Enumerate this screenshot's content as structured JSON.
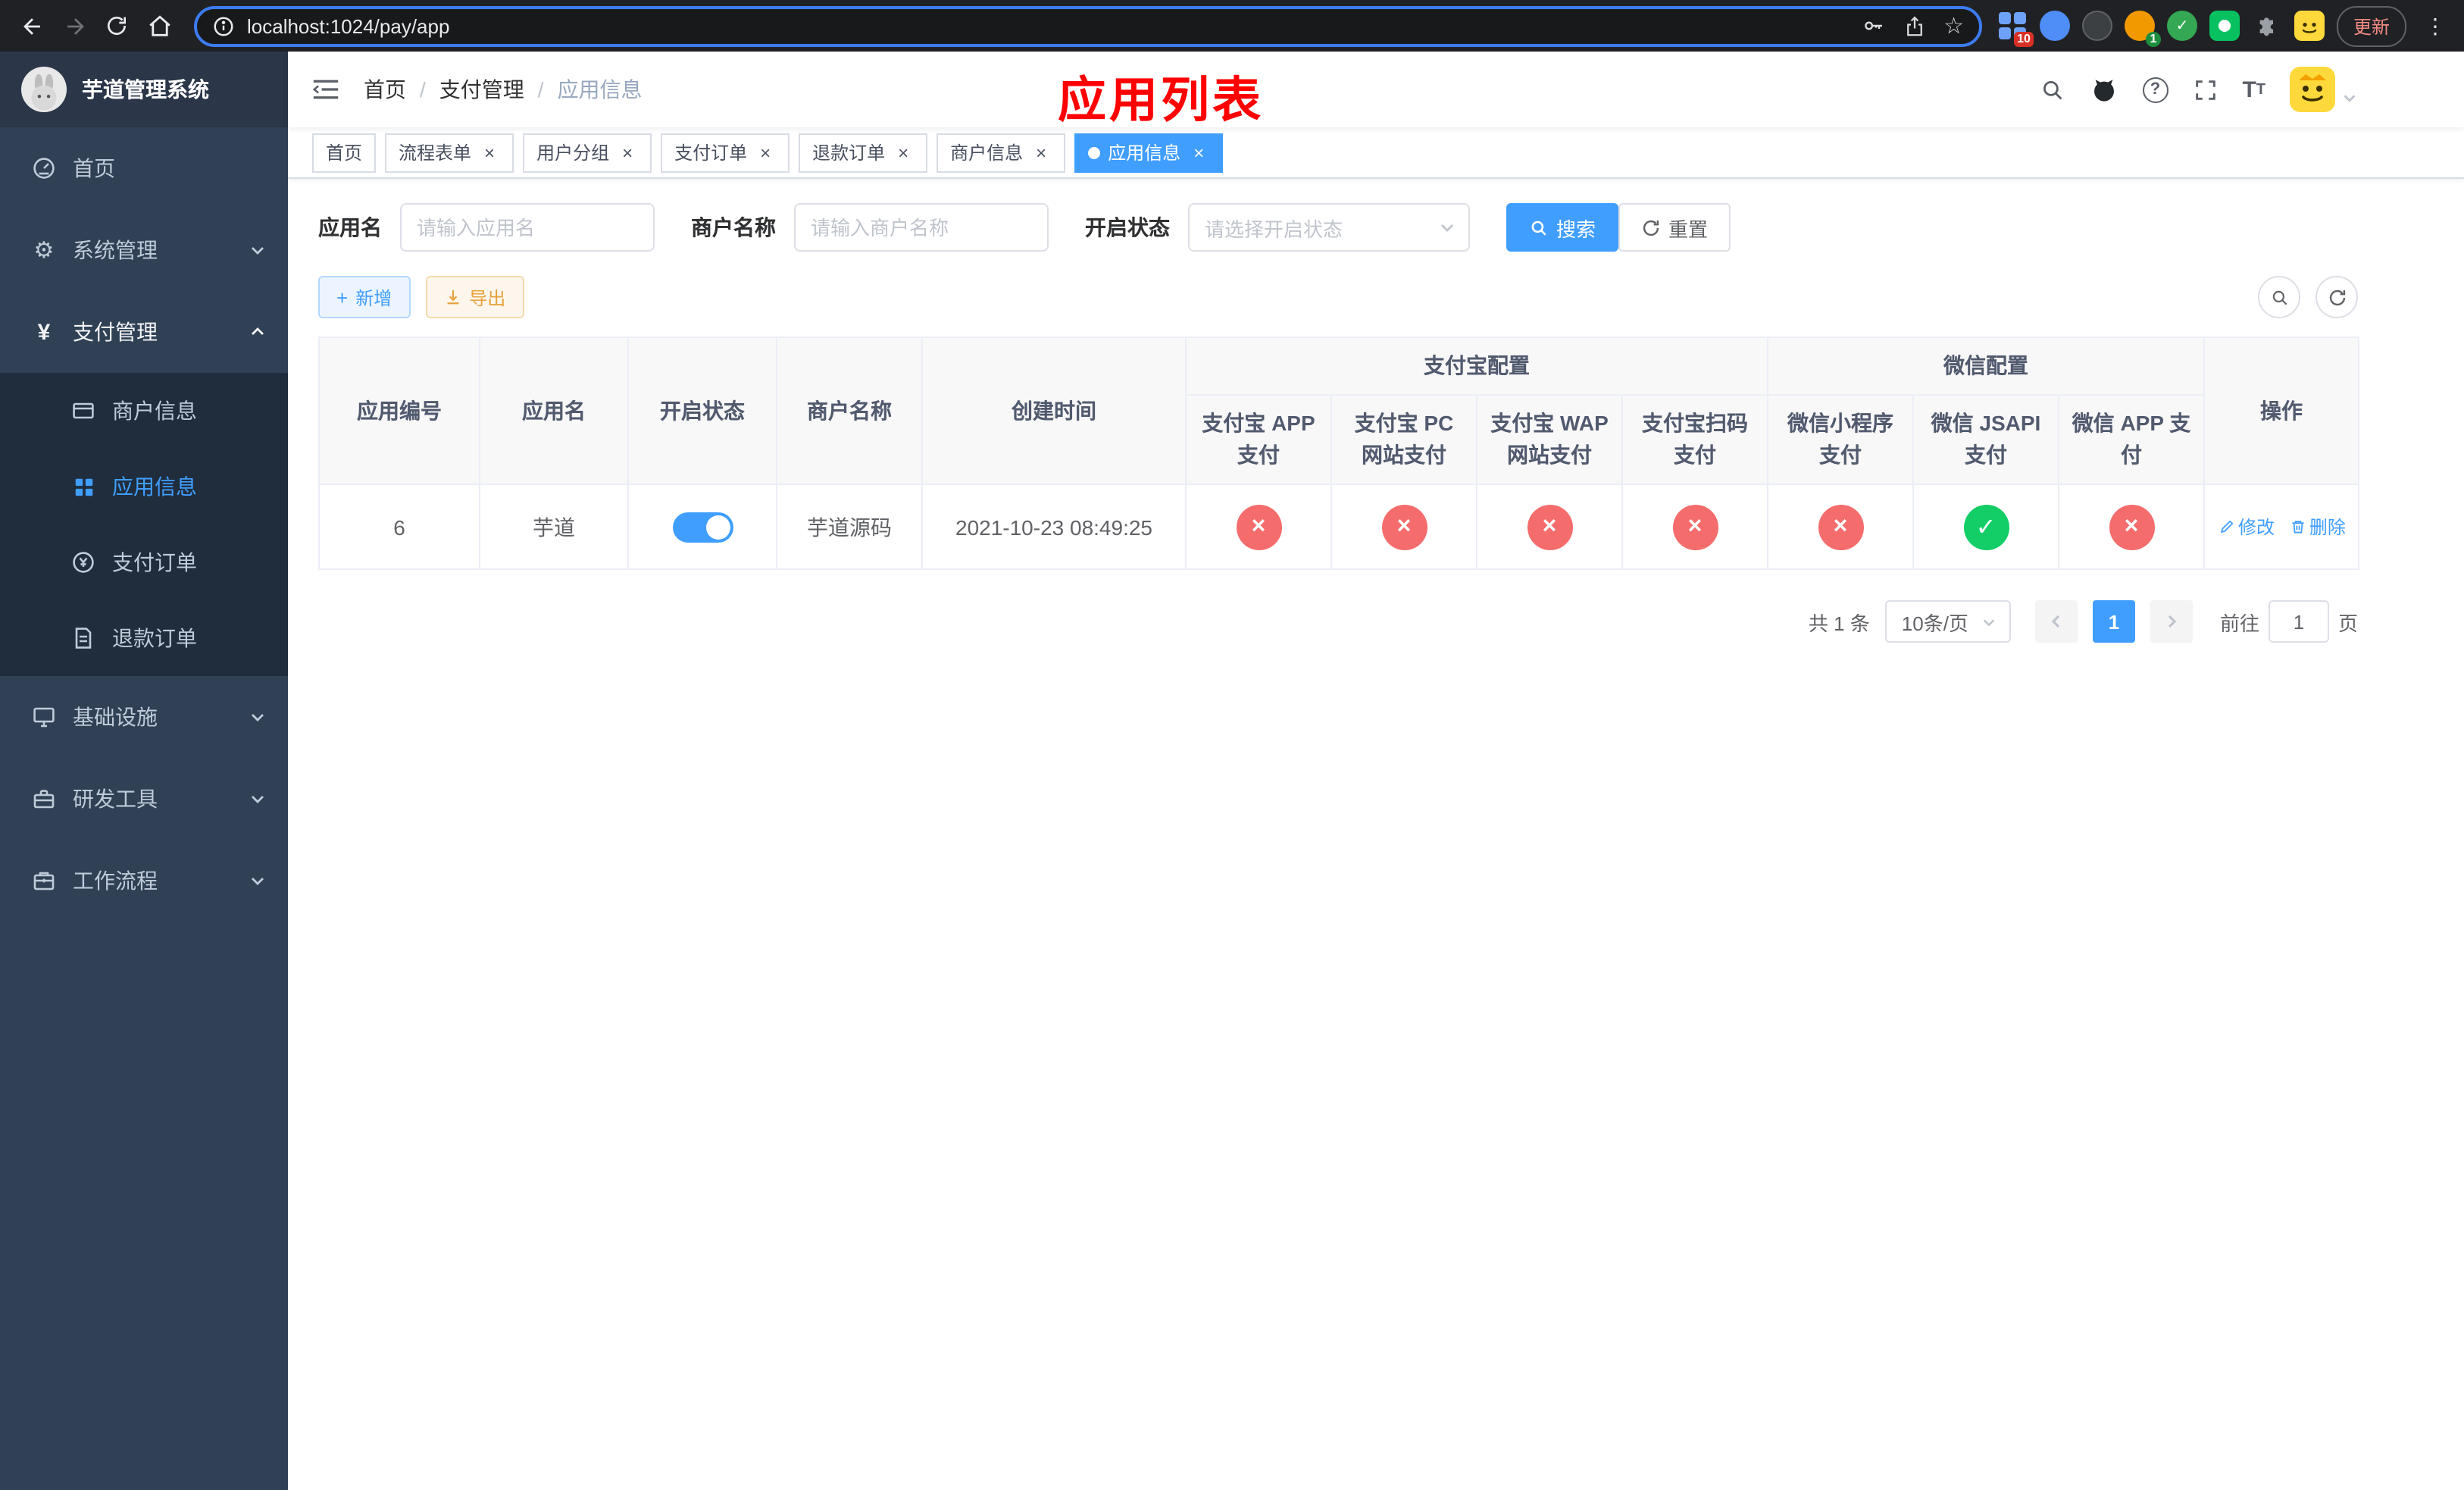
{
  "colors": {
    "primary": "#409eff",
    "danger": "#f56c6c",
    "success": "#13ce66",
    "warning": "#e6a23c",
    "sidebar_bg": "#304156",
    "annotation_red": "#ff0000"
  },
  "icons": {
    "check": "✓",
    "cross": "×",
    "gear": "⚙",
    "star": "☆",
    "overflow_menu": "⋮",
    "yen": "¥",
    "plus": "+"
  },
  "browser": {
    "url": "localhost:1024/pay/app",
    "update_label": "更新",
    "ext_badge_grid": "10",
    "ext_badge_avatar": "1"
  },
  "sidebar": {
    "logo_title": "芋道管理系统",
    "menu_home": "首页",
    "menu_system": "系统管理",
    "menu_payment": "支付管理",
    "menu_infra": "基础设施",
    "menu_devtools": "研发工具",
    "menu_workflow": "工作流程",
    "sub_merchant": "商户信息",
    "sub_app": "应用信息",
    "sub_pay_order": "支付订单",
    "sub_refund_order": "退款订单"
  },
  "navbar": {
    "breadcrumb_home": "首页",
    "breadcrumb_section": "支付管理",
    "breadcrumb_current": "应用信息",
    "overlay_title": "应用列表"
  },
  "tabs": [
    {
      "label": "首页"
    },
    {
      "label": "流程表单"
    },
    {
      "label": "用户分组"
    },
    {
      "label": "支付订单"
    },
    {
      "label": "退款订单"
    },
    {
      "label": "商户信息"
    },
    {
      "label": "应用信息"
    }
  ],
  "filters": {
    "app_name_label": "应用名",
    "app_name_placeholder": "请输入应用名",
    "merchant_label": "商户名称",
    "merchant_placeholder": "请输入商户名称",
    "status_label": "开启状态",
    "status_placeholder": "请选择开启状态",
    "search_button": "搜索",
    "reset_button": "重置"
  },
  "toolbar": {
    "add_button": "新增",
    "export_button": "导出"
  },
  "table": {
    "headers": {
      "app_id": "应用编号",
      "app_name": "应用名",
      "status": "开启状态",
      "merchant": "商户名称",
      "create_time": "创建时间",
      "alipay_group": "支付宝配置",
      "wechat_group": "微信配置",
      "alipay_app": "支付宝 APP 支付",
      "alipay_pc": "支付宝 PC 网站支付",
      "alipay_wap": "支付宝 WAP 网站支付",
      "alipay_qr": "支付宝扫码支付",
      "wx_mini": "微信小程序支付",
      "wx_jsapi": "微信 JSAPI 支付",
      "wx_app": "微信 APP 支付",
      "actions": "操作"
    },
    "rows": [
      {
        "app_id": "6",
        "app_name": "芋道",
        "enabled": true,
        "merchant": "芋道源码",
        "create_time": "2021-10-23 08:49:25",
        "channels": {
          "alipay_app": false,
          "alipay_pc": false,
          "alipay_wap": false,
          "alipay_qr": false,
          "wx_mini": false,
          "wx_jsapi": true,
          "wx_app": false
        },
        "edit_label": "修改",
        "delete_label": "删除"
      }
    ]
  },
  "pagination": {
    "total_text": "共 1 条",
    "page_size_text": "10条/页",
    "current_page": "1",
    "goto_prefix": "前往",
    "goto_value": "1",
    "goto_suffix": "页"
  }
}
